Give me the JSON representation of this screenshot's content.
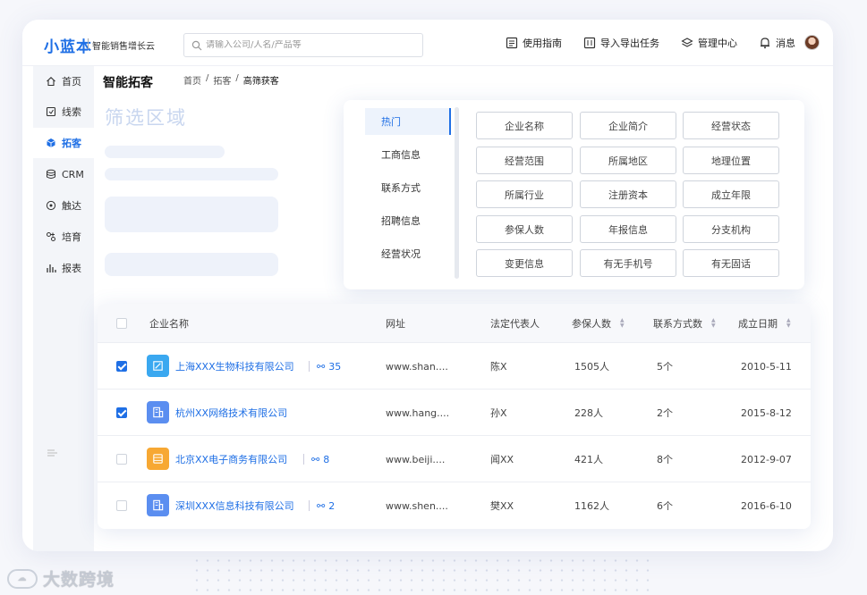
{
  "brand": {
    "logo": "小蓝本",
    "subtitle": "智能销售增长云"
  },
  "search": {
    "placeholder": "请输入公司/人名/产品等"
  },
  "topnav": [
    {
      "label": "使用指南",
      "icon": "guide-icon"
    },
    {
      "label": "导入导出任务",
      "icon": "import-export-icon"
    },
    {
      "label": "管理中心",
      "icon": "layers-icon"
    },
    {
      "label": "消息",
      "icon": "bell-icon"
    }
  ],
  "sidebar": {
    "items": [
      {
        "label": "首页",
        "icon": "home-icon"
      },
      {
        "label": "线索",
        "icon": "clue-icon"
      },
      {
        "label": "拓客",
        "icon": "prospect-icon",
        "active": true
      },
      {
        "label": "CRM",
        "icon": "crm-icon"
      },
      {
        "label": "触达",
        "icon": "target-icon"
      },
      {
        "label": "培育",
        "icon": "nurture-icon"
      },
      {
        "label": "报表",
        "icon": "report-icon"
      }
    ]
  },
  "page": {
    "title": "智能拓客",
    "breadcrumb": [
      "首页",
      "/",
      "拓客",
      "/",
      "高筛获客"
    ],
    "filter_area_title": "筛选区域"
  },
  "filter_popover": {
    "categories": [
      "热门",
      "工商信息",
      "联系方式",
      "招聘信息",
      "经营状况"
    ],
    "active_category": "热门",
    "tags": [
      [
        "企业名称",
        "企业简介",
        "经营状态"
      ],
      [
        "经营范围",
        "所属地区",
        "地理位置"
      ],
      [
        "所属行业",
        "注册资本",
        "成立年限"
      ],
      [
        "参保人数",
        "年报信息",
        "分支机构"
      ],
      [
        "变更信息",
        "有无手机号",
        "有无固话"
      ]
    ]
  },
  "table": {
    "headers": {
      "company": "企业名称",
      "website": "网址",
      "legal_rep": "法定代表人",
      "insured": "参保人数",
      "contacts": "联系方式数",
      "founded": "成立日期"
    },
    "rows": [
      {
        "checked": true,
        "company": "上海XXX生物科技有限公司",
        "related": "35",
        "website": "www.shan....",
        "legal_rep": "陈X",
        "insured": "1505人",
        "contacts": "5个",
        "founded": "2010-5-11",
        "icon_color": "#3aa8f0"
      },
      {
        "checked": true,
        "company": "杭州XX网络技术有限公司",
        "related": "",
        "website": "www.hang....",
        "legal_rep": "孙X",
        "insured": "228人",
        "contacts": "2个",
        "founded": "2015-8-12",
        "icon_color": "#5b8ef0"
      },
      {
        "checked": false,
        "company": "北京XX电子商务有限公司",
        "related": "8",
        "website": "www.beiji....",
        "legal_rep": "闻XX",
        "insured": "421人",
        "contacts": "8个",
        "founded": "2012-9-07",
        "icon_color": "#f7a833"
      },
      {
        "checked": false,
        "company": "深圳XXX信息科技有限公司",
        "related": "2",
        "website": "www.shen....",
        "legal_rep": "樊XX",
        "insured": "1162人",
        "contacts": "6个",
        "founded": "2016-6-10",
        "icon_color": "#5b8ef0"
      }
    ]
  },
  "watermark": {
    "text": "大数跨境"
  },
  "colors": {
    "accent": "#1f6fe5",
    "skeleton": "#eef2fa"
  }
}
